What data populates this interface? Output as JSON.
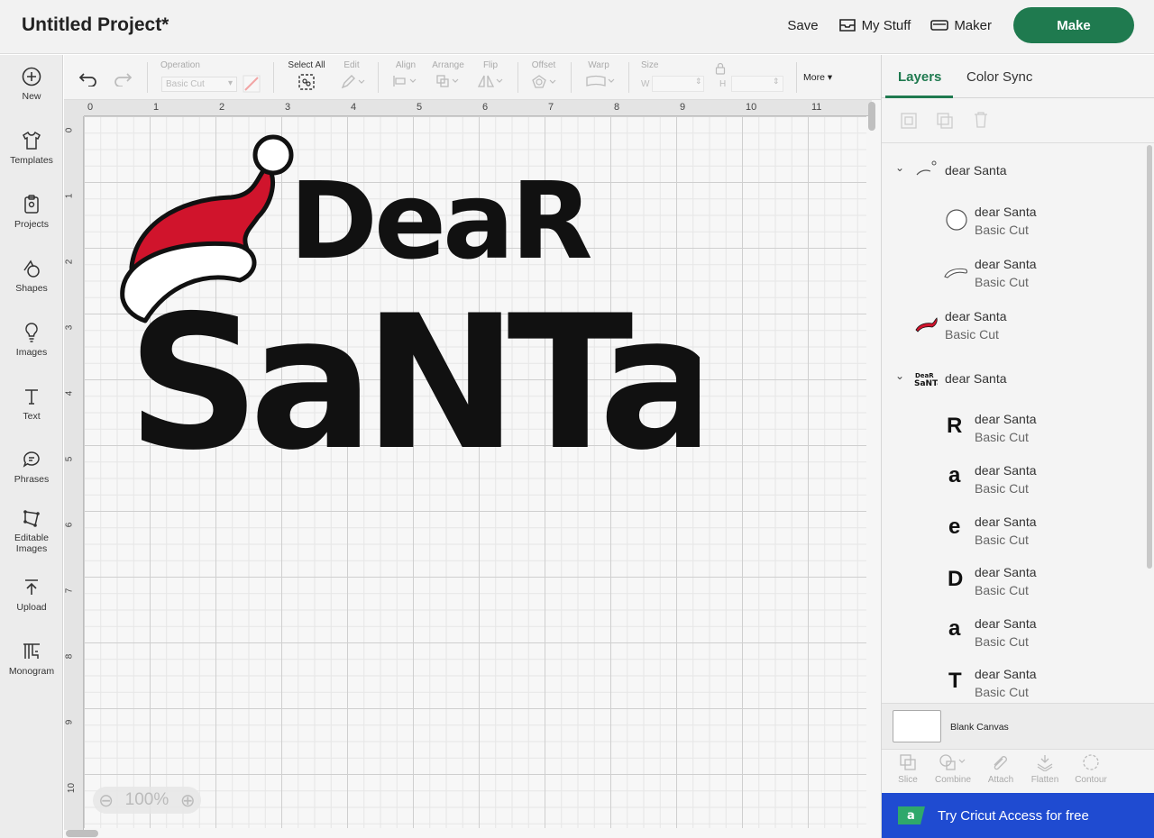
{
  "header": {
    "title": "Untitled Project*",
    "save_label": "Save",
    "my_stuff_label": "My Stuff",
    "machine_label": "Maker",
    "make_label": "Make"
  },
  "sidebar": {
    "items": [
      {
        "label": "New",
        "icon": "plus-circle-icon"
      },
      {
        "label": "Templates",
        "icon": "shirt-icon"
      },
      {
        "label": "Projects",
        "icon": "clipboard-icon"
      },
      {
        "label": "Shapes",
        "icon": "shapes-icon"
      },
      {
        "label": "Images",
        "icon": "lightbulb-icon"
      },
      {
        "label": "Text",
        "icon": "text-t-icon"
      },
      {
        "label": "Phrases",
        "icon": "speech-bubble-icon"
      },
      {
        "label": "Editable",
        "label2": "Images",
        "icon": "editable-image-icon"
      },
      {
        "label": "Upload",
        "icon": "upload-icon"
      },
      {
        "label": "Monogram",
        "icon": "monogram-icon"
      }
    ]
  },
  "toolbar": {
    "operation_label": "Operation",
    "operation_value": "Basic Cut",
    "select_all_label": "Select All",
    "edit_label": "Edit",
    "align_label": "Align",
    "arrange_label": "Arrange",
    "flip_label": "Flip",
    "offset_label": "Offset",
    "warp_label": "Warp",
    "size_label": "Size",
    "w_label": "W",
    "h_label": "H",
    "more_label": "More"
  },
  "canvas": {
    "ruler_top": [
      "0",
      "1",
      "2",
      "3",
      "4",
      "5",
      "6",
      "7",
      "8",
      "9",
      "10",
      "11"
    ],
    "ruler_left": [
      "0",
      "1",
      "2",
      "3",
      "4",
      "5",
      "6",
      "7",
      "8",
      "9",
      "10"
    ],
    "zoom_level": "100%",
    "artwork": {
      "line1": "DeaR",
      "line2": "SaNTa",
      "hat_color": "#d0142c",
      "ink_color": "#111111"
    }
  },
  "right_panel": {
    "tabs": [
      "Layers",
      "Color Sync"
    ],
    "groups": [
      {
        "name": "dear Santa",
        "children": [
          {
            "name": "dear Santa",
            "op": "Basic Cut",
            "thumb": "circle"
          },
          {
            "name": "dear Santa",
            "op": "Basic Cut",
            "thumb": "brim"
          }
        ]
      },
      {
        "name": "dear Santa",
        "op": "Basic Cut",
        "thumb": "hat",
        "standalone": true
      },
      {
        "name": "dear Santa",
        "children": [
          {
            "name": "dear Santa",
            "op": "Basic Cut",
            "thumb": "R"
          },
          {
            "name": "dear Santa",
            "op": "Basic Cut",
            "thumb": "a"
          },
          {
            "name": "dear Santa",
            "op": "Basic Cut",
            "thumb": "e"
          },
          {
            "name": "dear Santa",
            "op": "Basic Cut",
            "thumb": "D"
          },
          {
            "name": "dear Santa",
            "op": "Basic Cut",
            "thumb": "a"
          },
          {
            "name": "dear Santa",
            "op": "Basic Cut",
            "thumb": "T"
          }
        ]
      }
    ],
    "blank_canvas_label": "Blank Canvas",
    "bottom_tools": [
      "Slice",
      "Combine",
      "Attach",
      "Flatten",
      "Contour"
    ],
    "banner_text": "Try Cricut Access for free"
  }
}
